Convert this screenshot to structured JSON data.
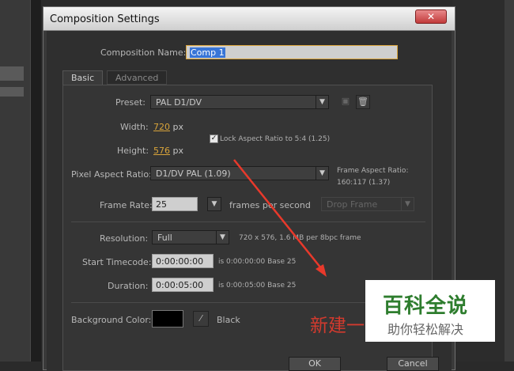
{
  "dialog": {
    "title": "Composition Settings",
    "close_symbol": "✕"
  },
  "composition_name": {
    "label": "Composition Name:",
    "value": "Comp 1"
  },
  "tabs": [
    {
      "label": "Basic"
    },
    {
      "label": "Advanced"
    }
  ],
  "preset": {
    "label": "Preset:",
    "value": "PAL D1/DV"
  },
  "width": {
    "label": "Width:",
    "value": "720",
    "unit": "px"
  },
  "height": {
    "label": "Height:",
    "value": "576",
    "unit": "px"
  },
  "lock_aspect": {
    "label": "Lock Aspect Ratio to 5:4 (1.25)",
    "checked": true
  },
  "pixel_aspect": {
    "label": "Pixel Aspect Ratio:",
    "value": "D1/DV PAL (1.09)",
    "frame_aspect_label": "Frame Aspect Ratio:",
    "frame_aspect_value": "160:117 (1.37)"
  },
  "frame_rate": {
    "label": "Frame Rate:",
    "value": "25",
    "suffix": "frames per second",
    "drop_frame": "Drop Frame"
  },
  "resolution": {
    "label": "Resolution:",
    "value": "Full",
    "info": "720 x 576, 1.6 MB per 8bpc frame"
  },
  "start_timecode": {
    "label": "Start Timecode:",
    "value": "0:00:00:00",
    "info": "is 0:00:00:00  Base 25"
  },
  "duration": {
    "label": "Duration:",
    "value": "0:00:05:00",
    "info": "is 0:00:05:00  Base 25"
  },
  "background_color": {
    "label": "Background Color:",
    "name": "Black",
    "swatch": "#000000"
  },
  "buttons": {
    "ok": "OK",
    "cancel": "Cancel"
  },
  "annotation": {
    "text": "新建一",
    "color": "#d23a2e"
  },
  "watermark": {
    "title": "百科全说",
    "subtitle": "助你轻松解决"
  }
}
